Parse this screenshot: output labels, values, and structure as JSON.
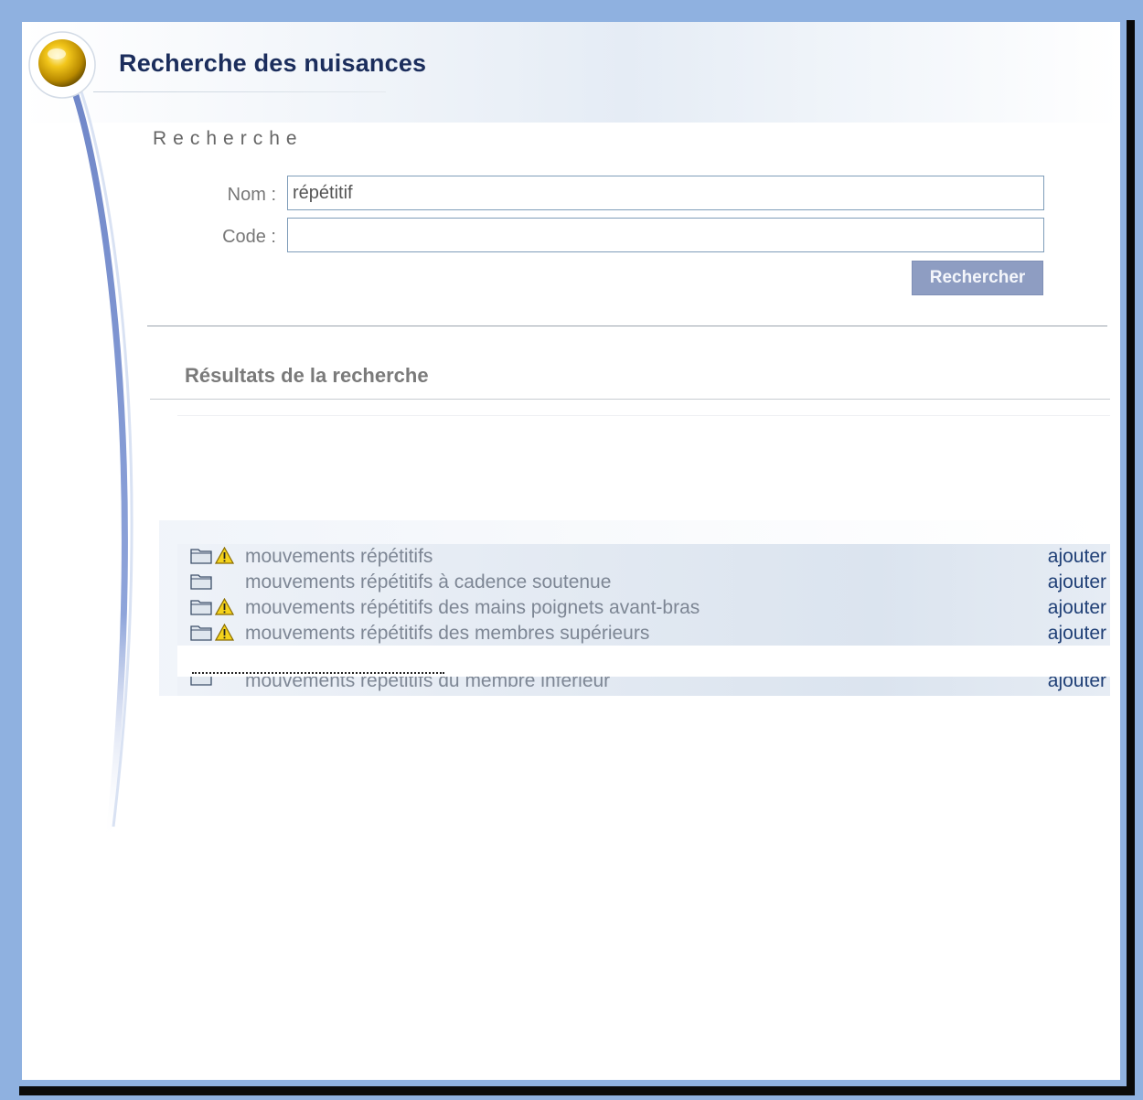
{
  "header": {
    "title": "Recherche des nuisances"
  },
  "search": {
    "section_label": "Recherche",
    "nom_label": "Nom :",
    "nom_value": "répétitif",
    "code_label": "Code :",
    "code_value": "",
    "submit_label": "Rechercher"
  },
  "results": {
    "heading": "Résultats de la recherche",
    "action_label": "ajouter",
    "items": [
      {
        "label": "mouvements répétitifs",
        "warning": true,
        "action": "ajouter"
      },
      {
        "label": "mouvements répétitifs à cadence soutenue",
        "warning": false,
        "action": "ajouter"
      },
      {
        "label": "mouvements répétitifs des mains poignets avant-bras",
        "warning": true,
        "action": "ajouter"
      },
      {
        "label": "mouvements répétitifs des membres supérieurs",
        "warning": true,
        "action": "ajouter"
      },
      {
        "label": "mouvements répétitifs du membre inférieur",
        "warning": false,
        "action": "ajouter"
      }
    ]
  },
  "icons": {
    "folder": "folder-icon",
    "warning": "warning-icon",
    "bullet": "gold-orb-icon"
  },
  "colors": {
    "frame": "#8fb1e0",
    "title": "#1b2d5c",
    "button": "#8e9dc2",
    "link": "#1f3f76",
    "row_text": "#7d8694"
  }
}
